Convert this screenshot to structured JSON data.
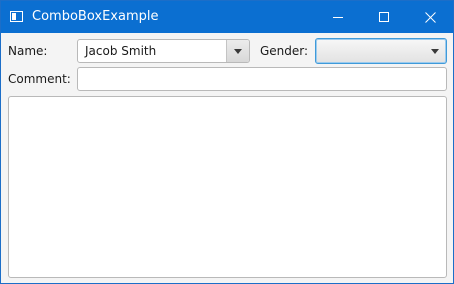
{
  "window": {
    "title": "ComboBoxExample",
    "accent_color": "#0b6fd1",
    "controls": {
      "minimize_icon": "minimize-icon",
      "maximize_icon": "maximize-icon",
      "close_icon": "close-icon"
    }
  },
  "form": {
    "name_label": "Name:",
    "name_value": "Jacob Smith",
    "gender_label": "Gender:",
    "gender_value": "",
    "comment_label": "Comment:",
    "comment_value": "",
    "textarea_value": ""
  }
}
